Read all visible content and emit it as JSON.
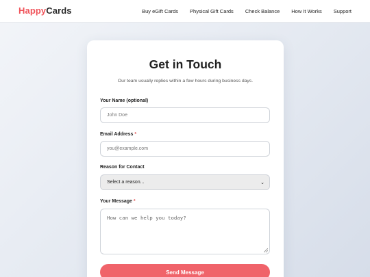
{
  "brand": {
    "part1": "Happy",
    "part2": "Cards",
    "accent_color": "#f0535a"
  },
  "nav": {
    "items": [
      "Buy eGift Cards",
      "Physical Gift Cards",
      "Check Balance",
      "How It Works",
      "Support"
    ]
  },
  "form": {
    "title": "Get in Touch",
    "subtitle": "Our team usually replies within a few hours during business days.",
    "name": {
      "label": "Your Name (optional)",
      "placeholder": "John Doe"
    },
    "email": {
      "label": "Email Address",
      "required_mark": "*",
      "placeholder": "you@example.com"
    },
    "reason": {
      "label": "Reason for Contact",
      "selected": "Select a reason..."
    },
    "message": {
      "label": "Your Message",
      "required_mark": "*",
      "placeholder": "How can we help you today?"
    },
    "submit_label": "Send Message",
    "button_color": "#f0636a"
  }
}
